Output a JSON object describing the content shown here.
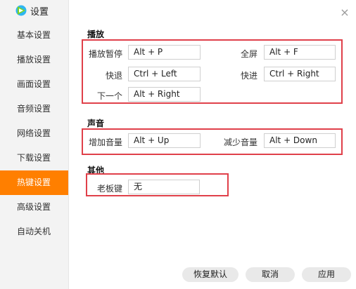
{
  "window": {
    "title": "设置",
    "close_glyph": "×"
  },
  "sidebar": {
    "items": [
      {
        "label": "基本设置",
        "active": false
      },
      {
        "label": "播放设置",
        "active": false
      },
      {
        "label": "画面设置",
        "active": false
      },
      {
        "label": "音频设置",
        "active": false
      },
      {
        "label": "网络设置",
        "active": false
      },
      {
        "label": "下载设置",
        "active": false
      },
      {
        "label": "热键设置",
        "active": true
      },
      {
        "label": "高级设置",
        "active": false
      },
      {
        "label": "自动关机",
        "active": false
      }
    ]
  },
  "sections": {
    "playback": {
      "title": "播放",
      "play_pause": {
        "label": "播放暂停",
        "value": "Alt + P"
      },
      "fullscreen": {
        "label": "全屏",
        "value": "Alt + F"
      },
      "rewind": {
        "label": "快退",
        "value": "Ctrl + Left"
      },
      "forward": {
        "label": "快进",
        "value": "Ctrl + Right"
      },
      "next": {
        "label": "下一个",
        "value": "Alt + Right"
      }
    },
    "sound": {
      "title": "声音",
      "volume_up": {
        "label": "增加音量",
        "value": "Alt + Up"
      },
      "volume_down": {
        "label": "减少音量",
        "value": "Alt + Down"
      }
    },
    "other": {
      "title": "其他",
      "boss_key": {
        "label": "老板键",
        "value": "无"
      }
    }
  },
  "footer": {
    "restore_default": "恢复默认",
    "cancel": "取消",
    "apply": "应用"
  },
  "colors": {
    "accent": "#ff7f00",
    "highlight_box": "#e0404a"
  }
}
